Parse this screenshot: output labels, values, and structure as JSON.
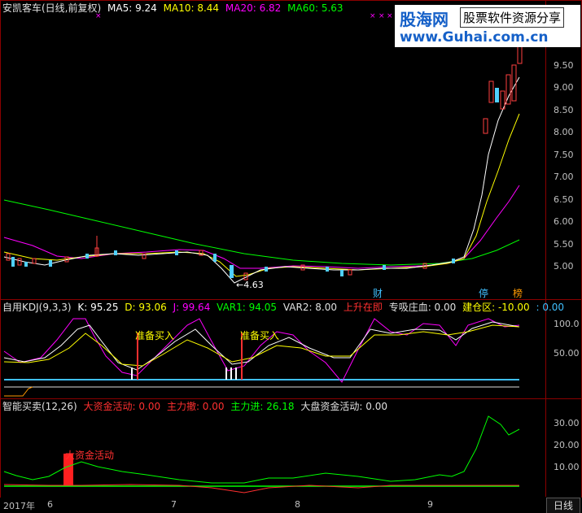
{
  "main": {
    "title": "安凯客车(日线,前复权)",
    "ma5": "MA5: 9.24",
    "ma10": "MA10: 8.44",
    "ma20": "MA20: 6.82",
    "ma60": "MA60: 5.63",
    "low_marker": "←4.63",
    "price_ticks": [
      "9.50",
      "9.00",
      "8.50",
      "8.00",
      "7.50",
      "7.00",
      "6.50",
      "6.00",
      "5.50",
      "5.00"
    ],
    "tags": {
      "cai": "财",
      "ting": "停",
      "bang": "榜"
    }
  },
  "kdj": {
    "name": "自用KDJ(9,3,3)",
    "k": "K: 95.25",
    "d": "D: 93.06",
    "j": "J: 99.64",
    "var1": "VAR1: 94.05",
    "var2": "VAR2: 8.00",
    "shangsheng": "上升在即",
    "zhuanxi": "专吸庄血: 0.00",
    "jiancang": "建仓区: -10.00",
    "tail": ": 0.00",
    "signal1": "准备买入",
    "signal2": "准备买入",
    "ticks": [
      "100.0",
      "50.00"
    ]
  },
  "smart": {
    "name": "智能买卖(12,26)",
    "big_fund": "大资金活动: 0.00",
    "main_out": "主力撤: 0.00",
    "main_in": "主力进: 26.18",
    "market_fund": "大盘资金活动: 0.00",
    "annotation": "大资金活动",
    "ticks": [
      "30.00",
      "20.00",
      "10.00"
    ]
  },
  "dates": {
    "year": "2017年",
    "m6": "6",
    "m7": "7",
    "m8": "8",
    "m9": "9"
  },
  "period": "日线",
  "logo": {
    "title": "股海网",
    "slogan": "股票软件资源分享",
    "url": "www.Guhai.com.cn"
  },
  "colors": {
    "ma5": "#ffffff",
    "ma10": "#ffff00",
    "ma20": "#ff00ff",
    "ma60": "#00ff00",
    "frame": "#8b0000"
  }
}
